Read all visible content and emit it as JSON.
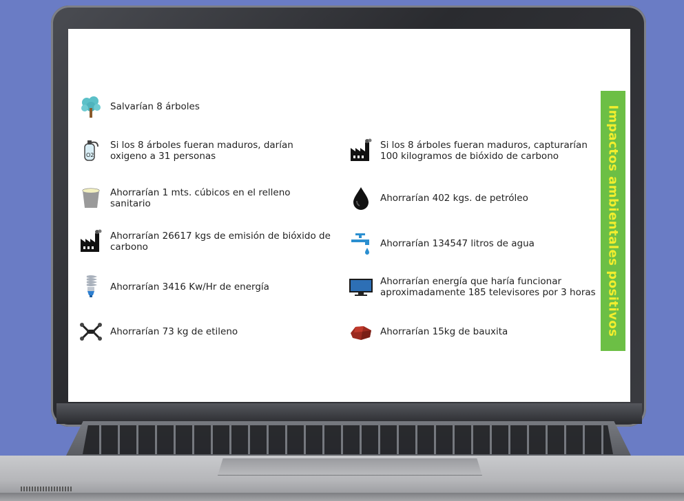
{
  "banner": {
    "title": "Impactos ambientales positivos"
  },
  "items": [
    {
      "label": "Salvarían 8 árboles",
      "icon": "tree-icon"
    },
    {
      "label": "Si los 8 árboles fueran maduros, darían oxigeno a 31 personas",
      "icon": "oxygen-tank-icon"
    },
    {
      "label": "Si los 8 árboles fueran maduros, capturarían 100 kilogramos de bióxido de carbono",
      "icon": "factory-icon"
    },
    {
      "label": "Ahorrarían 1 mts. cúbicos en el relleno sanitario",
      "icon": "bucket-icon"
    },
    {
      "label": "Ahorrarían 402 kgs. de petróleo",
      "icon": "oil-drop-icon"
    },
    {
      "label": "Ahorrarían 26617 kgs de emisión de bióxido de carbono",
      "icon": "factory-icon"
    },
    {
      "label": "Ahorrarían 134547 litros de agua",
      "icon": "water-faucet-icon"
    },
    {
      "label": "Ahorrarían 3416 Kw/Hr de energía",
      "icon": "light-bulb-icon"
    },
    {
      "label": "Ahorrarían energía que haría funcionar aproximadamente 185 televisores por 3 horas",
      "icon": "television-icon"
    },
    {
      "label": "Ahorrarían 73 kg de etileno",
      "icon": "molecule-icon"
    },
    {
      "label": "Ahorrarían 15kg de bauxita",
      "icon": "bauxite-rock-icon"
    }
  ],
  "colors": {
    "background": "#6a7cc5",
    "banner": "#6cbf45",
    "banner_text": "#f2ee2e",
    "tree": "#5bc0c8",
    "water": "#2b8fd0"
  }
}
